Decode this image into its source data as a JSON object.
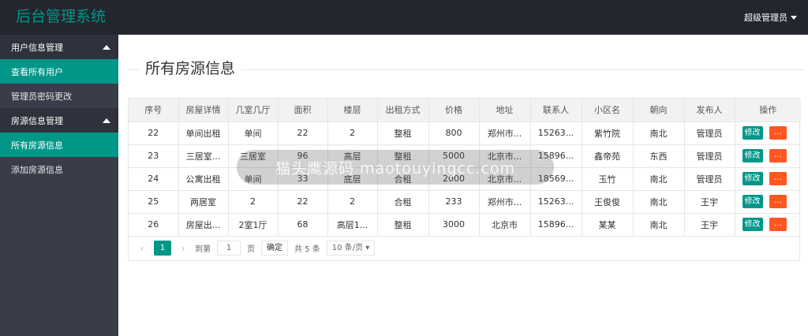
{
  "app": {
    "title": "后台管理系统",
    "user": "超级管理员"
  },
  "sidebar": {
    "groups": [
      {
        "label": "用户信息管理",
        "items": [
          "查看所有用户",
          "管理员密码更改"
        ]
      },
      {
        "label": "房源信息管理",
        "items": [
          "所有房源信息",
          "添加房源信息"
        ]
      }
    ],
    "active": [
      "查看所有用户",
      "所有房源信息"
    ]
  },
  "main": {
    "title": "所有房源信息",
    "columns": [
      "序号",
      "房屋详情",
      "几室几厅",
      "面积",
      "楼层",
      "出租方式",
      "价格",
      "地址",
      "联系人",
      "小区名",
      "朝向",
      "发布人",
      "操作"
    ],
    "rows": [
      [
        "22",
        "单间出租",
        "单间",
        "22",
        "2",
        "整租",
        "800",
        "郑州市...",
        "15263...",
        "紫竹院",
        "南北",
        "管理员"
      ],
      [
        "23",
        "三居室...",
        "三居室",
        "96",
        "高层",
        "整租",
        "5000",
        "北京市...",
        "15896...",
        "鑫帝苑",
        "东西",
        "管理员"
      ],
      [
        "24",
        "公寓出租",
        "单间",
        "33",
        "底层",
        "合租",
        "2000",
        "北京市...",
        "18569...",
        "玉竹",
        "南北",
        "管理员"
      ],
      [
        "25",
        "两居室",
        "2",
        "22",
        "2",
        "合租",
        "233",
        "郑州市...",
        "15263...",
        "王俊俊",
        "南北",
        "王宇"
      ],
      [
        "26",
        "房屋出...",
        "2室1厅",
        "68",
        "高层1...",
        "整租",
        "3000",
        "北京市",
        "15896...",
        "某某",
        "南北",
        "王宇"
      ]
    ],
    "edit_label": "修改",
    "delete_label": "...",
    "pager": {
      "prev": "‹",
      "current": "1",
      "next": "›",
      "goto_label": "到第",
      "goto_value": "1",
      "page_unit": "页",
      "confirm": "确定",
      "total": "共 5 条",
      "page_size": "10 条/页"
    }
  },
  "watermark": "猫头鹰源码 maotouyingcc.com"
}
